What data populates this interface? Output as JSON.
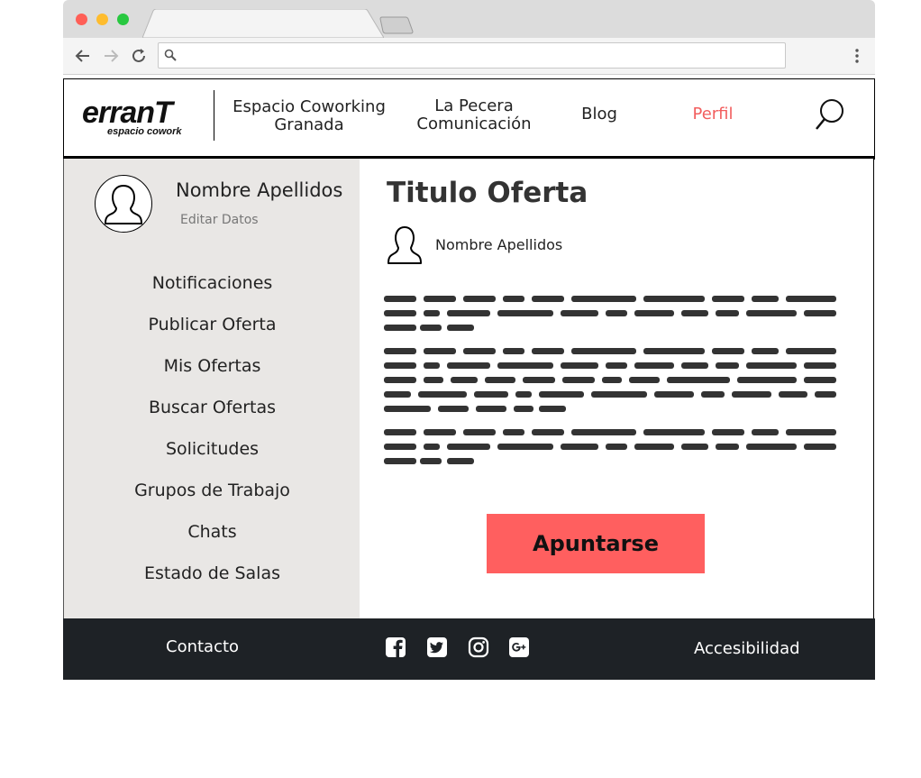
{
  "colors": {
    "accent": "#ff5f5f",
    "active_nav": "#f25e5e",
    "sidebar_bg": "#e9e7e5",
    "footer_bg": "#1e2226",
    "placeholder_text_bars": "#333333"
  },
  "browser": {
    "address_value": "",
    "icons": [
      "back-icon",
      "forward-icon",
      "reload-icon",
      "search-icon",
      "kebab-menu-icon"
    ]
  },
  "header": {
    "logo": {
      "main": "erranT",
      "sub": "espacio cowork"
    },
    "nav": [
      {
        "line1": "Espacio Coworking",
        "line2": "Granada"
      },
      {
        "line1": "La Pecera",
        "line2": "Comunicación"
      },
      {
        "line1": "Blog",
        "line2": ""
      },
      {
        "line1": "Perfil",
        "line2": ""
      }
    ],
    "active_nav": "Perfil"
  },
  "sidebar": {
    "user_name": "Nombre Apellidos",
    "edit_label": "Editar Datos",
    "items": [
      "Notificaciones",
      "Publicar Oferta",
      "Mis Ofertas",
      "Buscar Ofertas",
      "Solicitudes",
      "Grupos de Trabajo",
      "Chats",
      "Estado de Salas"
    ]
  },
  "main": {
    "title": "Titulo Oferta",
    "author": "Nombre Apellidos",
    "apply_label": "Apuntarse"
  },
  "footer": {
    "contact": "Contacto",
    "accessibility": "Accesibilidad",
    "social": [
      "facebook-icon",
      "twitter-icon",
      "instagram-icon",
      "google-plus-icon"
    ]
  }
}
